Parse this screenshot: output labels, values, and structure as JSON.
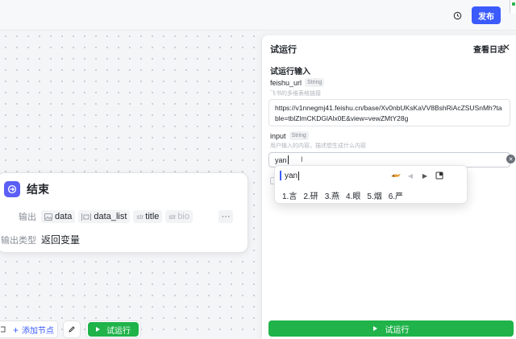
{
  "header": {
    "publish_label": "发布",
    "history_icon": "history-clock-icon"
  },
  "end_node": {
    "title": "结束",
    "output_label": "输出",
    "outputs": [
      {
        "type_icon": "image",
        "name": "data"
      },
      {
        "type_icon": "list",
        "name": "data_list"
      },
      {
        "type_icon": "str",
        "name": "title"
      },
      {
        "type_icon": "str",
        "name": "bio"
      }
    ],
    "more_label": "···",
    "output_type_label": "输出类型",
    "output_type_value": "返回变量"
  },
  "bottom_toolbar": {
    "add_node_label": "添加节点",
    "run_label": "试运行"
  },
  "panel": {
    "title": "试运行",
    "view_log_label": "查看日志",
    "section_title": "试运行输入",
    "fields": [
      {
        "name": "feishu_url",
        "type": "String",
        "description": "飞书的多维表格链接",
        "value": "https://v1nnegmj41.feishu.cn/base/Xv0nbUKsKaVV8BshRiAcZSUSnMh?table=tblZlmCKDGlAlx0E&view=vewZMtY28g"
      },
      {
        "name": "input",
        "type": "String",
        "description": "用户输入的内容，描述想生成什么内容",
        "value": "yan"
      }
    ],
    "run_label": "试运行"
  },
  "ime": {
    "composition": "yan",
    "candidates": [
      "1.言",
      "2.研",
      "3.燕",
      "4.眼",
      "5.烟",
      "6.严"
    ]
  },
  "colors": {
    "primary": "#3b5bfd",
    "run_green": "#1fb34a",
    "end_icon": "#5b5ff5"
  }
}
